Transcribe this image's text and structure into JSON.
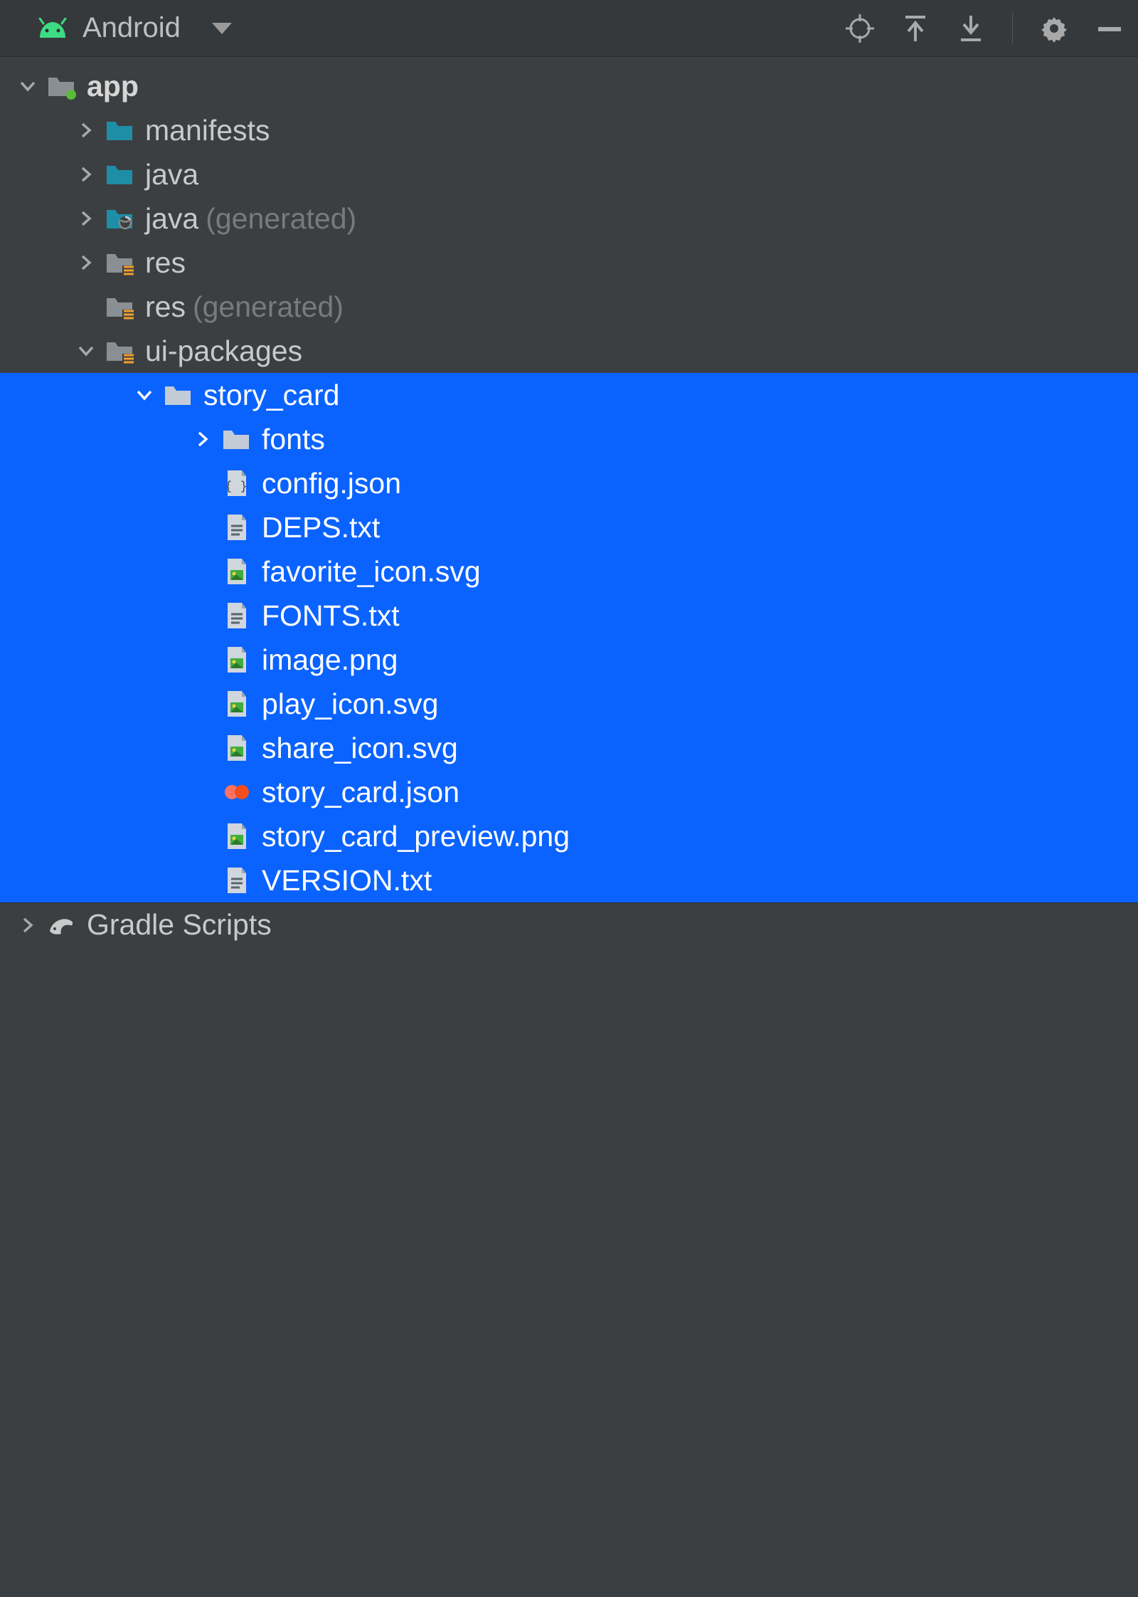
{
  "toolbar": {
    "view_name": "Android"
  },
  "tree": [
    {
      "id": "app",
      "depth": 0,
      "arrow": "down",
      "icon": "module-folder",
      "label": "app",
      "bold": true,
      "selected": false,
      "suffix": ""
    },
    {
      "id": "manifests",
      "depth": 1,
      "arrow": "right",
      "icon": "folder-teal",
      "label": "manifests",
      "bold": false,
      "selected": false,
      "suffix": ""
    },
    {
      "id": "java",
      "depth": 1,
      "arrow": "right",
      "icon": "folder-teal",
      "label": "java",
      "bold": false,
      "selected": false,
      "suffix": ""
    },
    {
      "id": "java-gen",
      "depth": 1,
      "arrow": "right",
      "icon": "folder-teal-gen",
      "label": "java",
      "bold": false,
      "selected": false,
      "suffix": "(generated)"
    },
    {
      "id": "res",
      "depth": 1,
      "arrow": "right",
      "icon": "resource-folder",
      "label": "res",
      "bold": false,
      "selected": false,
      "suffix": ""
    },
    {
      "id": "res-gen",
      "depth": 1,
      "arrow": "none",
      "icon": "resource-folder",
      "label": "res",
      "bold": false,
      "selected": false,
      "suffix": "(generated)"
    },
    {
      "id": "ui-packages",
      "depth": 1,
      "arrow": "down",
      "icon": "resource-folder",
      "label": "ui-packages",
      "bold": false,
      "selected": false,
      "suffix": ""
    },
    {
      "id": "story_card",
      "depth": 2,
      "arrow": "down",
      "icon": "folder-sel",
      "label": "story_card",
      "bold": false,
      "selected": true,
      "suffix": ""
    },
    {
      "id": "fonts",
      "depth": 3,
      "arrow": "right",
      "icon": "folder-sel",
      "label": "fonts",
      "bold": false,
      "selected": true,
      "suffix": ""
    },
    {
      "id": "config",
      "depth": 3,
      "arrow": "none",
      "icon": "json-file",
      "label": "config.json",
      "bold": false,
      "selected": true,
      "suffix": ""
    },
    {
      "id": "deps",
      "depth": 3,
      "arrow": "none",
      "icon": "txt-file",
      "label": "DEPS.txt",
      "bold": false,
      "selected": true,
      "suffix": ""
    },
    {
      "id": "favicon",
      "depth": 3,
      "arrow": "none",
      "icon": "image-file",
      "label": "favorite_icon.svg",
      "bold": false,
      "selected": true,
      "suffix": ""
    },
    {
      "id": "fontstxt",
      "depth": 3,
      "arrow": "none",
      "icon": "txt-file",
      "label": "FONTS.txt",
      "bold": false,
      "selected": true,
      "suffix": ""
    },
    {
      "id": "imagepng",
      "depth": 3,
      "arrow": "none",
      "icon": "image-file",
      "label": "image.png",
      "bold": false,
      "selected": true,
      "suffix": ""
    },
    {
      "id": "playicon",
      "depth": 3,
      "arrow": "none",
      "icon": "image-file",
      "label": "play_icon.svg",
      "bold": false,
      "selected": true,
      "suffix": ""
    },
    {
      "id": "shareicon",
      "depth": 3,
      "arrow": "none",
      "icon": "image-file",
      "label": "share_icon.svg",
      "bold": false,
      "selected": true,
      "suffix": ""
    },
    {
      "id": "storyjson",
      "depth": 3,
      "arrow": "none",
      "icon": "figma-file",
      "label": "story_card.json",
      "bold": false,
      "selected": true,
      "suffix": ""
    },
    {
      "id": "preview",
      "depth": 3,
      "arrow": "none",
      "icon": "image-file",
      "label": "story_card_preview.png",
      "bold": false,
      "selected": true,
      "suffix": ""
    },
    {
      "id": "version",
      "depth": 3,
      "arrow": "none",
      "icon": "txt-file",
      "label": "VERSION.txt",
      "bold": false,
      "selected": true,
      "suffix": ""
    },
    {
      "id": "gradle",
      "depth": 0,
      "arrow": "right",
      "icon": "gradle",
      "label": "Gradle Scripts",
      "bold": false,
      "selected": false,
      "suffix": "",
      "bottom": true
    }
  ]
}
